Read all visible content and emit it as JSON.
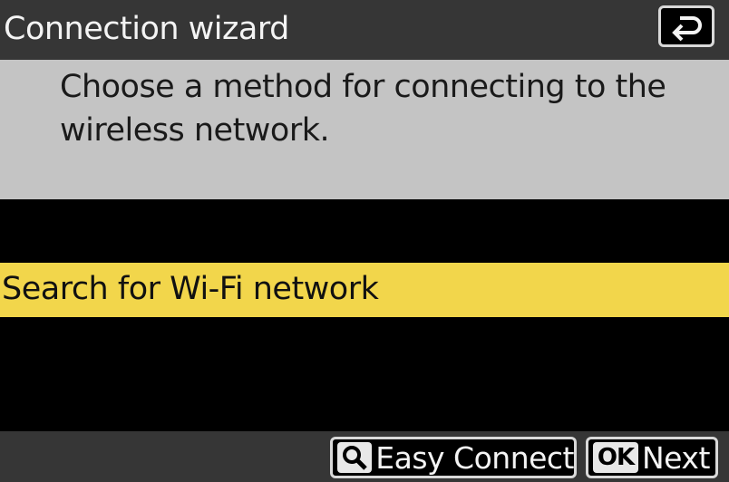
{
  "header": {
    "title": "Connection wizard",
    "back_icon": "return-arrow-icon"
  },
  "instruction": {
    "text": "Choose a method for connecting to the wireless network."
  },
  "menu": {
    "items": [
      {
        "label": "Search for Wi-Fi network",
        "selected": true
      }
    ]
  },
  "footer": {
    "easy_connect": {
      "key_icon": "zoom-magnifier-icon",
      "label": "Easy Connect"
    },
    "next": {
      "key": "OK",
      "label": "Next"
    }
  },
  "colors": {
    "title_bar": "#363636",
    "panel": "#c4c4c4",
    "highlight": "#f2d64b",
    "background": "#000000"
  }
}
